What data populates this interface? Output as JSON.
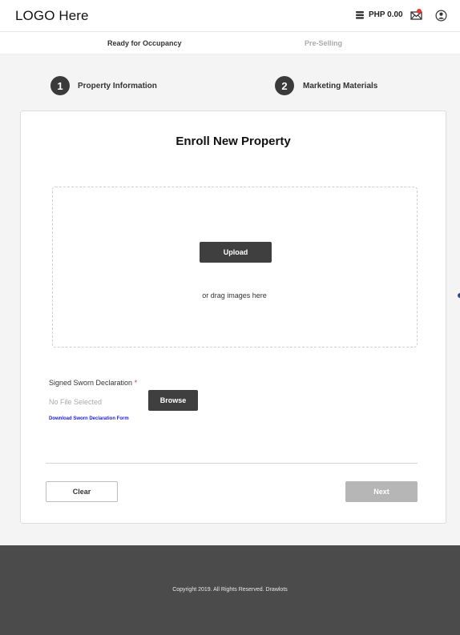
{
  "header": {
    "logo": "LOGO Here",
    "balance": "PHP 0.00",
    "icons": [
      "wallet-icon",
      "mail-icon",
      "user-icon"
    ]
  },
  "tabs": [
    {
      "label": "Ready for Occupancy",
      "active": true
    },
    {
      "label": "Pre-Selling",
      "active": false
    }
  ],
  "steps": [
    {
      "number": "1",
      "label": "Property Information"
    },
    {
      "number": "2",
      "label": "Marketing Materials"
    }
  ],
  "form": {
    "title": "Enroll New Property",
    "upload_label": "Upload",
    "drag_text": "or drag images here",
    "declaration_label": "Signed Sworn Declaration",
    "required_marker": "*",
    "file_status": "No File Selected",
    "browse_label": "Browse",
    "download_link": "Download Sworn Declaration Form",
    "clear_label": "Clear",
    "next_label": "Next"
  },
  "footer": {
    "copyright": "Copyright 2019. All Rights Reserved. Drawlots"
  },
  "colors": {
    "dark_button": "#3f3f3f",
    "disabled_button": "#b6b6b6",
    "link": "#2222cc",
    "required": "#e53935",
    "footer_bg": "#4b4b4b"
  }
}
